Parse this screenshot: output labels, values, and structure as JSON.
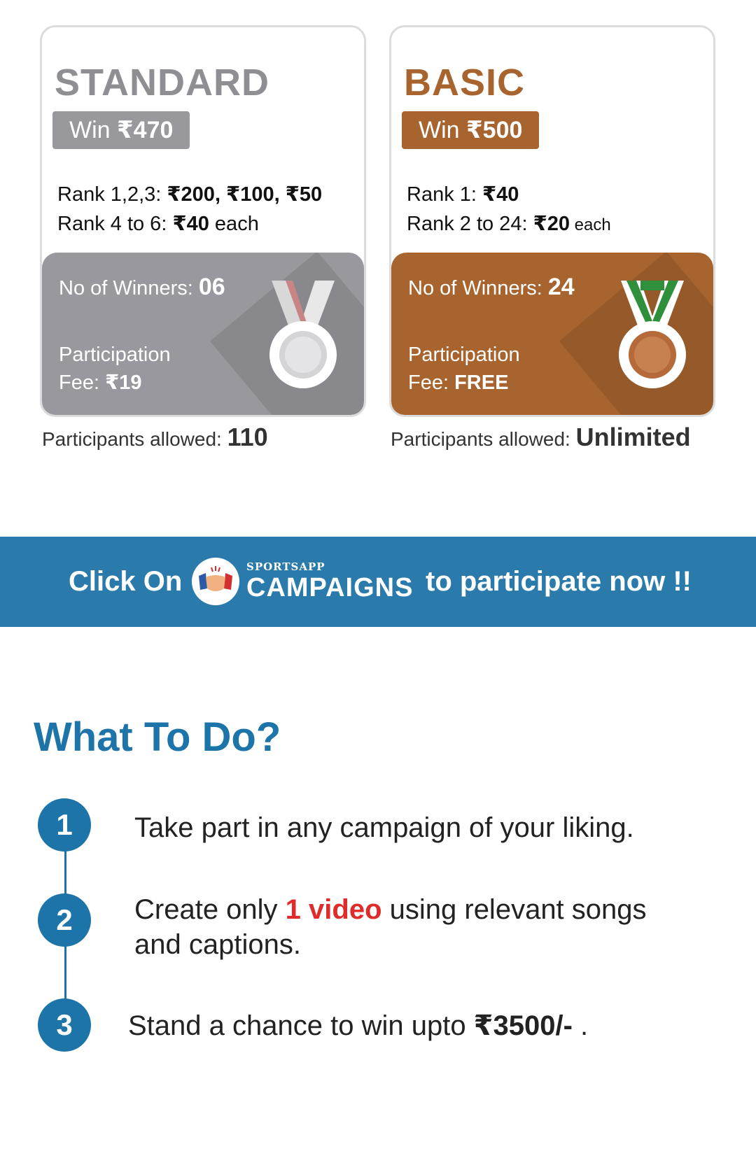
{
  "cards": {
    "standard": {
      "title": "STANDARD",
      "win_label": "Win ",
      "win_amount": "₹470",
      "rank_line1_label": "Rank 1,2,3: ",
      "rank_line1_value": "₹200, ₹100, ₹50",
      "rank_line2_label": "Rank 4 to 6: ",
      "rank_line2_value": "₹40",
      "rank_line2_suffix": " each",
      "winners_label": "No of Winners: ",
      "winners_value": "06",
      "fee_label1": "Participation",
      "fee_label2": "Fee: ",
      "fee_value": "₹19",
      "allowed_label": "Participants allowed: ",
      "allowed_value": "110",
      "medal_icon": "silver-medal-icon"
    },
    "basic": {
      "title": "BASIC",
      "win_label": "Win ",
      "win_amount": "₹500",
      "rank_line1_label": "Rank 1: ",
      "rank_line1_value": "₹40",
      "rank_line2_label": "Rank 2 to 24: ",
      "rank_line2_value": "₹20",
      "rank_line2_suffix": " each",
      "winners_label": "No of Winners: ",
      "winners_value": "24",
      "fee_label1": "Participation",
      "fee_label2": "Fee: ",
      "fee_value": "FREE",
      "allowed_label": "Participants allowed: ",
      "allowed_value": "Unlimited",
      "medal_icon": "bronze-medal-icon"
    }
  },
  "banner": {
    "left_text": "Click On",
    "logo_small": "SPORTSAPP",
    "logo_big": "CAMPAIGNS",
    "right_text": "to participate now !!",
    "logo_icon": "handshake-icon"
  },
  "what_to_do": {
    "title": "What To Do?",
    "steps": [
      {
        "num": "1",
        "text": "Take part in any campaign of your liking."
      },
      {
        "num": "2",
        "text_before": "Create only ",
        "text_highlight": "1 video",
        "text_after": " using relevant songs",
        "text_line2": "and captions."
      },
      {
        "num": "3",
        "text_before": "Stand a chance to win upto ",
        "text_bold": "₹3500/-",
        "text_after": " ."
      }
    ]
  },
  "colors": {
    "standard_grey": "#98989e",
    "basic_bronze": "#a8642e",
    "banner_blue": "#2a7aab",
    "title_blue": "#1d74a8",
    "highlight_red": "#e02b2b"
  }
}
